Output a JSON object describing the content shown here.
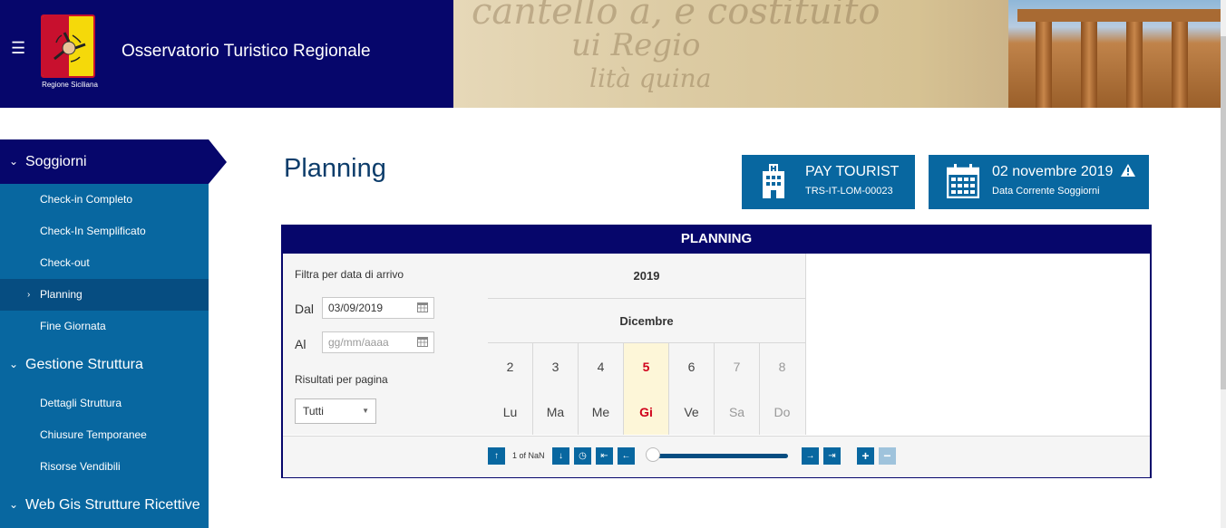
{
  "header": {
    "site_title": "Osservatorio Turistico Regionale",
    "logo_caption": "Regione Siciliana",
    "menu_icon": "hamburger-icon"
  },
  "sidebar": {
    "sections": [
      {
        "label": "Soggiorni",
        "active": true,
        "items": [
          {
            "label": "Check-in Completo"
          },
          {
            "label": "Check-In Semplificato"
          },
          {
            "label": "Check-out"
          },
          {
            "label": "Planning",
            "active": true
          },
          {
            "label": "Fine Giornata"
          }
        ]
      },
      {
        "label": "Gestione Struttura",
        "items": [
          {
            "label": "Dettagli Struttura"
          },
          {
            "label": "Chiusure Temporanee"
          },
          {
            "label": "Risorse Vendibili"
          }
        ]
      },
      {
        "label": "Web Gis Strutture Ricettive",
        "items": []
      }
    ]
  },
  "page": {
    "title": "Planning"
  },
  "info_boxes": {
    "tourist": {
      "title": "PAY TOURIST",
      "subtitle": "TRS-IT-LOM-00023",
      "icon": "hotel-icon"
    },
    "date": {
      "title": "02 novembre 2019",
      "subtitle": "Data Corrente Soggiorni",
      "icon": "calendar-icon",
      "badge_icon": "warning-icon"
    }
  },
  "planning": {
    "header": "PLANNING",
    "filter": {
      "title": "Filtra per data di arrivo",
      "from_label": "Dal",
      "from_value": "03/09/2019",
      "to_label": "Al",
      "to_placeholder": "gg/mm/aaaa",
      "results_label": "Risultati per pagina",
      "results_value": "Tutti"
    },
    "calendar": {
      "year": "2019",
      "month": "Dicembre",
      "days": [
        {
          "n": "2",
          "w": "Lu"
        },
        {
          "n": "3",
          "w": "Ma"
        },
        {
          "n": "4",
          "w": "Me"
        },
        {
          "n": "5",
          "w": "Gi",
          "today": true
        },
        {
          "n": "6",
          "w": "Ve"
        },
        {
          "n": "7",
          "w": "Sa",
          "weekend": true
        },
        {
          "n": "8",
          "w": "Do",
          "weekend": true
        }
      ]
    },
    "toolbar": {
      "pager": "1 of NaN"
    }
  },
  "colors": {
    "navy": "#06066b",
    "blue": "#0867a0",
    "today_red": "#d0021b"
  }
}
